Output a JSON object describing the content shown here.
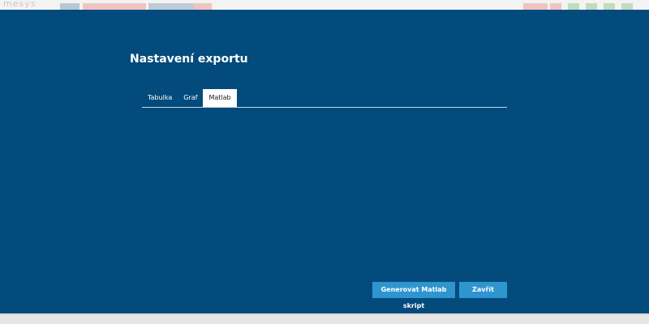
{
  "app_bar": {
    "logo_text": "mesys",
    "chip_colors": [
      "#a7b9c9",
      "#f3b1b1",
      "#b3c2cd",
      "#f3b1b1"
    ],
    "icon_colors": [
      "#f3b1b1",
      "#f3b1b1",
      "#b3d3b3",
      "#b3d3b3",
      "#b3d3b3",
      "#b3d3b3"
    ]
  },
  "modal": {
    "background": "#024b7c",
    "title": "Nastavení exportu",
    "tabs": [
      {
        "label": "Tabulka",
        "active": false
      },
      {
        "label": "Graf",
        "active": false
      },
      {
        "label": "Matlab",
        "active": true
      }
    ],
    "buttons": {
      "generate_label": "Generovat Matlab skript",
      "close_label": "Zavřít"
    },
    "accent_color": "#2f95cf"
  }
}
